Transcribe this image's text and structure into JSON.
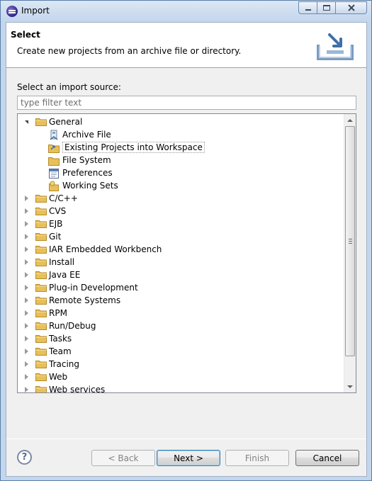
{
  "window": {
    "title": "Import"
  },
  "header": {
    "title": "Select",
    "description": "Create new projects from an archive file or directory."
  },
  "source": {
    "label": "Select an import source:",
    "filter_placeholder": "type filter text"
  },
  "tree": {
    "general": {
      "label": "General",
      "children": [
        {
          "label": "Archive File",
          "icon": "archive-file-icon"
        },
        {
          "label": "Existing Projects into Workspace",
          "icon": "existing-projects-icon",
          "selected": true
        },
        {
          "label": "File System",
          "icon": "file-system-folder-icon"
        },
        {
          "label": "Preferences",
          "icon": "preferences-icon"
        },
        {
          "label": "Working Sets",
          "icon": "working-sets-icon"
        }
      ]
    },
    "categories": [
      "C/C++",
      "CVS",
      "EJB",
      "Git",
      "IAR Embedded Workbench",
      "Install",
      "Java EE",
      "Plug-in Development",
      "Remote Systems",
      "RPM",
      "Run/Debug",
      "Tasks",
      "Team",
      "Tracing",
      "Web",
      "Web services"
    ]
  },
  "buttons": {
    "help": "?",
    "back": "< Back",
    "next": "Next >",
    "finish": "Finish",
    "cancel": "Cancel"
  },
  "colors": {
    "folder": "#e8c05a",
    "window_frame": "#c3d6ec",
    "default_button": "#3c7fb1"
  }
}
